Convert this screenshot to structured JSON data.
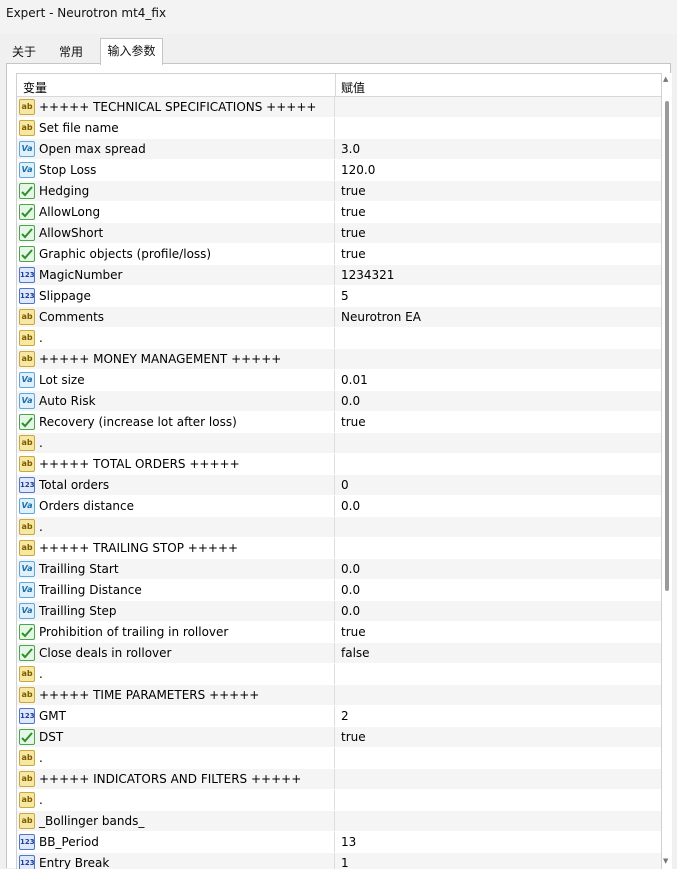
{
  "window": {
    "title": "Expert - Neurotron mt4_fix"
  },
  "tabs": [
    {
      "label": "关于"
    },
    {
      "label": "常用"
    },
    {
      "label": "输入参数",
      "active": true
    }
  ],
  "table": {
    "columns": {
      "variable": "变量",
      "value": "赋值"
    },
    "rows": [
      {
        "icon": "ab",
        "name": "+++++   TECHNICAL SPECIFICATIONS   +++++",
        "value": ""
      },
      {
        "icon": "ab",
        "name": "Set file name",
        "value": ""
      },
      {
        "icon": "va",
        "name": "Open max spread",
        "value": "3.0"
      },
      {
        "icon": "va",
        "name": "Stop Loss",
        "value": "120.0"
      },
      {
        "icon": "bool",
        "name": "Hedging",
        "value": "true"
      },
      {
        "icon": "bool",
        "name": "AllowLong",
        "value": "true"
      },
      {
        "icon": "bool",
        "name": "AllowShort",
        "value": "true"
      },
      {
        "icon": "bool",
        "name": "Graphic objects (profile/loss)",
        "value": "true"
      },
      {
        "icon": "num",
        "name": "MagicNumber",
        "value": "1234321"
      },
      {
        "icon": "num",
        "name": "Slippage",
        "value": "5"
      },
      {
        "icon": "ab",
        "name": "Comments",
        "value": "Neurotron EA"
      },
      {
        "icon": "ab",
        "name": ".",
        "value": ""
      },
      {
        "icon": "ab",
        "name": "+++++   MONEY MANAGEMENT   +++++",
        "value": ""
      },
      {
        "icon": "va",
        "name": "Lot size",
        "value": "0.01"
      },
      {
        "icon": "va",
        "name": "Auto Risk",
        "value": "0.0"
      },
      {
        "icon": "bool",
        "name": "Recovery (increase lot after loss)",
        "value": "true"
      },
      {
        "icon": "ab",
        "name": ".",
        "value": ""
      },
      {
        "icon": "ab",
        "name": "+++++   TOTAL ORDERS   +++++",
        "value": ""
      },
      {
        "icon": "num",
        "name": "Total orders",
        "value": "0"
      },
      {
        "icon": "va",
        "name": "Orders distance",
        "value": "0.0"
      },
      {
        "icon": "ab",
        "name": ".",
        "value": ""
      },
      {
        "icon": "ab",
        "name": "+++++   TRAILING STOP   +++++",
        "value": ""
      },
      {
        "icon": "va",
        "name": "Trailling Start",
        "value": "0.0"
      },
      {
        "icon": "va",
        "name": "Trailling Distance",
        "value": "0.0"
      },
      {
        "icon": "va",
        "name": "Trailling Step",
        "value": "0.0"
      },
      {
        "icon": "bool",
        "name": "Prohibition of trailing in rollover",
        "value": "true"
      },
      {
        "icon": "bool",
        "name": "Close deals in rollover",
        "value": "false"
      },
      {
        "icon": "ab",
        "name": ".",
        "value": ""
      },
      {
        "icon": "ab",
        "name": "+++++   TIME PARAMETERS   +++++",
        "value": ""
      },
      {
        "icon": "num",
        "name": "GMT",
        "value": "2"
      },
      {
        "icon": "bool",
        "name": "DST",
        "value": "true"
      },
      {
        "icon": "ab",
        "name": ".",
        "value": ""
      },
      {
        "icon": "ab",
        "name": "+++++   INDICATORS AND FILTERS   +++++",
        "value": ""
      },
      {
        "icon": "ab",
        "name": ".",
        "value": ""
      },
      {
        "icon": "ab",
        "name": "_Bollinger bands_",
        "value": ""
      },
      {
        "icon": "num",
        "name": "BB_Period",
        "value": "13"
      },
      {
        "icon": "num",
        "name": "Entry Break",
        "value": "1"
      }
    ]
  },
  "icons": {
    "ab": "string-type-icon",
    "va": "double-type-icon",
    "bool": "bool-type-icon",
    "num": "int-type-icon"
  }
}
